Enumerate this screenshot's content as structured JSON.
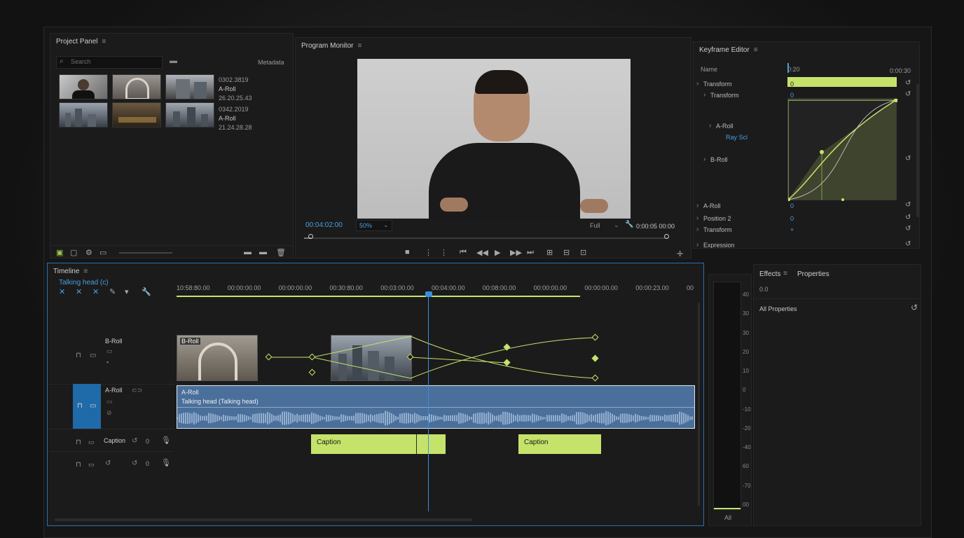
{
  "project": {
    "title": "Project Panel",
    "search_placeholder": "Search",
    "metadata_label": "Metadata",
    "items": [
      {
        "line1": "0302.3819",
        "line2": "A-Roll",
        "line3": "26.20.25.43"
      },
      {
        "line1": "0342.2019",
        "line2": "A-Roll",
        "line3": "21.24.28.28"
      }
    ]
  },
  "program": {
    "title": "Program Monitor",
    "timecode": "00:04:02:00",
    "zoom_value": "50%",
    "fit_value": "Full",
    "duration": "0:00:05 00:00",
    "playhead_progress": 0.02
  },
  "keyframe": {
    "title": "Keyframe Editor",
    "name_col": "Name",
    "time_start": "0:20",
    "time_end": "0:00:30",
    "rows": [
      {
        "label": "Transform",
        "value": "0"
      },
      {
        "label": "Transform",
        "value": "0"
      },
      {
        "label": "A-Roll",
        "value": ""
      },
      {
        "label": "Ray Scl",
        "value": ""
      },
      {
        "label": "B-Roll",
        "value": ""
      },
      {
        "label": "A-Roll",
        "value": "0"
      },
      {
        "label": "Position 2",
        "value": "0"
      },
      {
        "label": "Transform",
        "value": "+"
      },
      {
        "label": "Expression",
        "value": ""
      }
    ]
  },
  "timeline": {
    "title": "Timeline",
    "sequence": "Talking head (c)",
    "ruler": [
      "10:58:80.00",
      "00:00:00.00",
      "00:00:00.00",
      "00:30:80.00",
      "00:03:00.00",
      "00:04:00.00",
      "00:08:00.00",
      "00:00:00.00",
      "00:00:00.00",
      "00:00:23.00",
      "00"
    ],
    "tracks": {
      "broll": "B-Roll",
      "broll_clip": "B-Roll",
      "aroll": "A-Roll",
      "aroll_clip_title": "A-Roll",
      "aroll_clip_sub": "Talking head (Talking head)",
      "caption": "Caption",
      "caption_count": "0",
      "empty_count": "0"
    },
    "captions": [
      "Caption",
      "Caption"
    ]
  },
  "effects": {
    "tab_effects": "Effects",
    "tab_properties": "Properties",
    "value": "0.0",
    "section": "All Properties"
  },
  "meter": {
    "ticks": [
      "0",
      "-10",
      "-20",
      "-30",
      "-40",
      "-50",
      "-60",
      "-70",
      "-80"
    ],
    "scale_labels": [
      "40",
      "30",
      "30",
      "20",
      "10",
      "0",
      "-10",
      "-20",
      "-40",
      "60",
      "-70",
      "00"
    ],
    "label": "All"
  },
  "colors": {
    "accent": "#c5e36b",
    "timecode": "#4a9fe0",
    "audio": "#4a6f9a"
  }
}
